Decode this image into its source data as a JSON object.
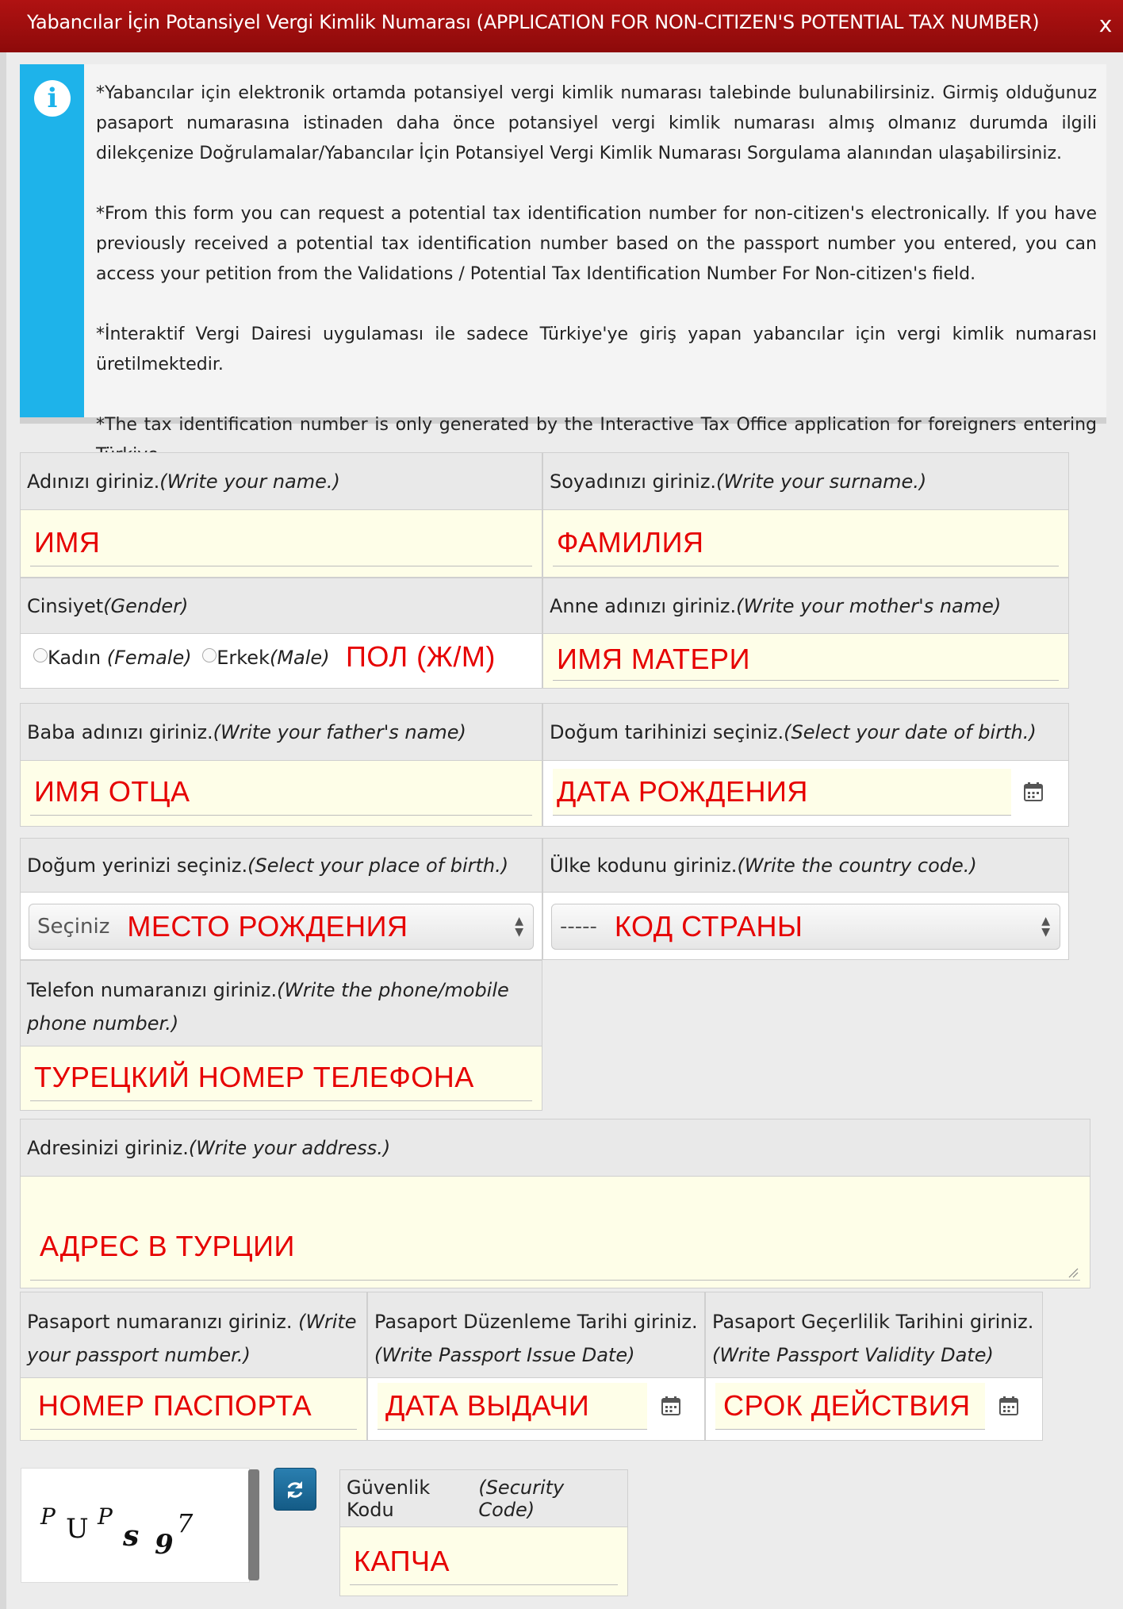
{
  "title": "Yabancılar İçin Potansiyel Vergi Kimlik Numarası (APPLICATION FOR NON-CITIZEN'S POTENTIAL TAX NUMBER)",
  "close_label": "x",
  "info": {
    "icon": "info-icon",
    "paragraphs": [
      "*Yabancılar için elektronik ortamda potansiyel vergi kimlik numarası talebinde bulunabilirsiniz. Girmiş olduğunuz pasaport numarasına istinaden daha önce potansiyel vergi kimlik numarası almış olmanız durumda ilgili dilekçenize Doğrulamalar/Yabancılar İçin Potansiyel Vergi Kimlik Numarası Sorgulama alanından ulaşabilirsiniz.",
      "*From this form you can request a potential tax identification number for non-citizen's electronically. If you have previously received a potential tax identification number based on the passport number you entered, you can access your petition from the Validations / Potential Tax Identification Number For Non-citizen's field.",
      "*İnteraktif Vergi Dairesi uygulaması ile sadece Türkiye'ye giriş yapan yabancılar için vergi kimlik numarası üretilmektedir.",
      "*The tax identification number is only generated by the Interactive Tax Office application for foreigners entering Türkiye."
    ]
  },
  "fields": {
    "name": {
      "label": "Adınızı giriniz.",
      "label_en": "(Write your name.)",
      "value": "ИМЯ"
    },
    "surname": {
      "label": "Soyadınızı giriniz.",
      "label_en": "(Write your surname.)",
      "value": "ФАМИЛИЯ"
    },
    "gender": {
      "label": "Cinsiyet ",
      "label_en": "(Gender)",
      "female": "Kadın ",
      "female_en": "(Female)",
      "male": "Erkek",
      "male_en": "(Male)",
      "value": "ПОЛ (Ж/М)"
    },
    "mother": {
      "label": "Anne adınızı giriniz. ",
      "label_en": "(Write your mother's name)",
      "value": "ИМЯ МАТЕРИ"
    },
    "father": {
      "label": "Baba adınızı giriniz. ",
      "label_en": "(Write your father's name)",
      "value": "ИМЯ ОТЦА"
    },
    "birthdate": {
      "label": "Doğum tarihinizi seçiniz. ",
      "label_en": "(Select your date of birth.)",
      "value": "ДАТА РОЖДЕНИЯ"
    },
    "birthplace": {
      "label": "Doğum yerinizi seçiniz.",
      "label_en": "(Select your place of birth.)",
      "placeholder": "Seçiniz",
      "value": "МЕСТО РОЖДЕНИЯ"
    },
    "country_code": {
      "label": "Ülke kodunu giriniz.",
      "label_en": "(Write the country code.)",
      "placeholder": "-----",
      "value": "КОД СТРАНЫ"
    },
    "phone": {
      "label": "Telefon numaranızı giriniz.",
      "label_en": "(Write the phone/mobile phone number.)",
      "value": "ТУРЕЦКИЙ НОМЕР ТЕЛЕФОНА"
    },
    "address": {
      "label": "Adresinizi giriniz. ",
      "label_en": "(Write your address.)",
      "value": "АДРЕС В ТУРЦИИ"
    },
    "passport_no": {
      "label": "Pasaport numaranızı giriniz. ",
      "label_en": "(Write your passport number.)",
      "value": "НОМЕР ПАСПОРТА"
    },
    "passport_issue": {
      "label": "Pasaport Düzenleme Tarihi giriniz. ",
      "label_en": "(Write Passport Issue Date)",
      "value": "ДАТА ВЫДАЧИ"
    },
    "passport_valid": {
      "label": "Pasaport Geçerlilik Tarihini giriniz. ",
      "label_en": "(Write Passport Validity Date)",
      "value": "СРОК ДЕЙСТВИЯ"
    },
    "security": {
      "label": "Güvenlik Kodu ",
      "label_en": "(Security Code)",
      "value": "КАПЧА"
    }
  },
  "captcha_chars": [
    "P",
    "U",
    "P",
    "s",
    "9",
    "7"
  ],
  "refresh_icon": "refresh-icon",
  "calendar_icon": "calendar-icon"
}
